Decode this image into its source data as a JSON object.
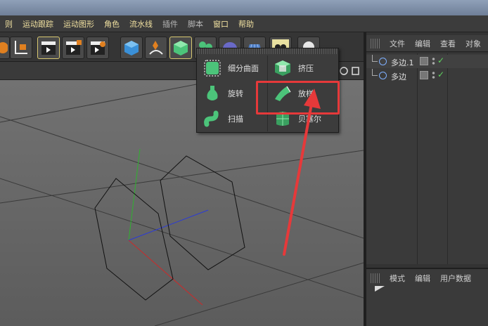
{
  "menubar": {
    "items": [
      "则",
      "运动跟踪",
      "运动图形",
      "角色",
      "流水线",
      "插件",
      "脚本",
      "窗口",
      "帮助"
    ]
  },
  "popup_menu": {
    "items": [
      {
        "label": "细分曲面",
        "icon": "subdivision-surface-icon"
      },
      {
        "label": "挤压",
        "icon": "extrude-icon"
      },
      {
        "label": "旋转",
        "icon": "lathe-icon"
      },
      {
        "label": "放样",
        "icon": "loft-icon"
      },
      {
        "label": "扫描",
        "icon": "sweep-icon"
      },
      {
        "label": "贝塞尔",
        "icon": "bezier-icon"
      }
    ]
  },
  "object_manager": {
    "tabs": [
      "文件",
      "编辑",
      "查看",
      "对象"
    ],
    "objects": [
      {
        "name": "多边.1",
        "check": "✓"
      },
      {
        "name": "多边",
        "check": "✓"
      }
    ]
  },
  "attribute_manager": {
    "tabs": [
      "模式",
      "编辑",
      "用户数据"
    ]
  },
  "annotation": {
    "color": "#e6393a",
    "highlighted_item": "放样"
  }
}
